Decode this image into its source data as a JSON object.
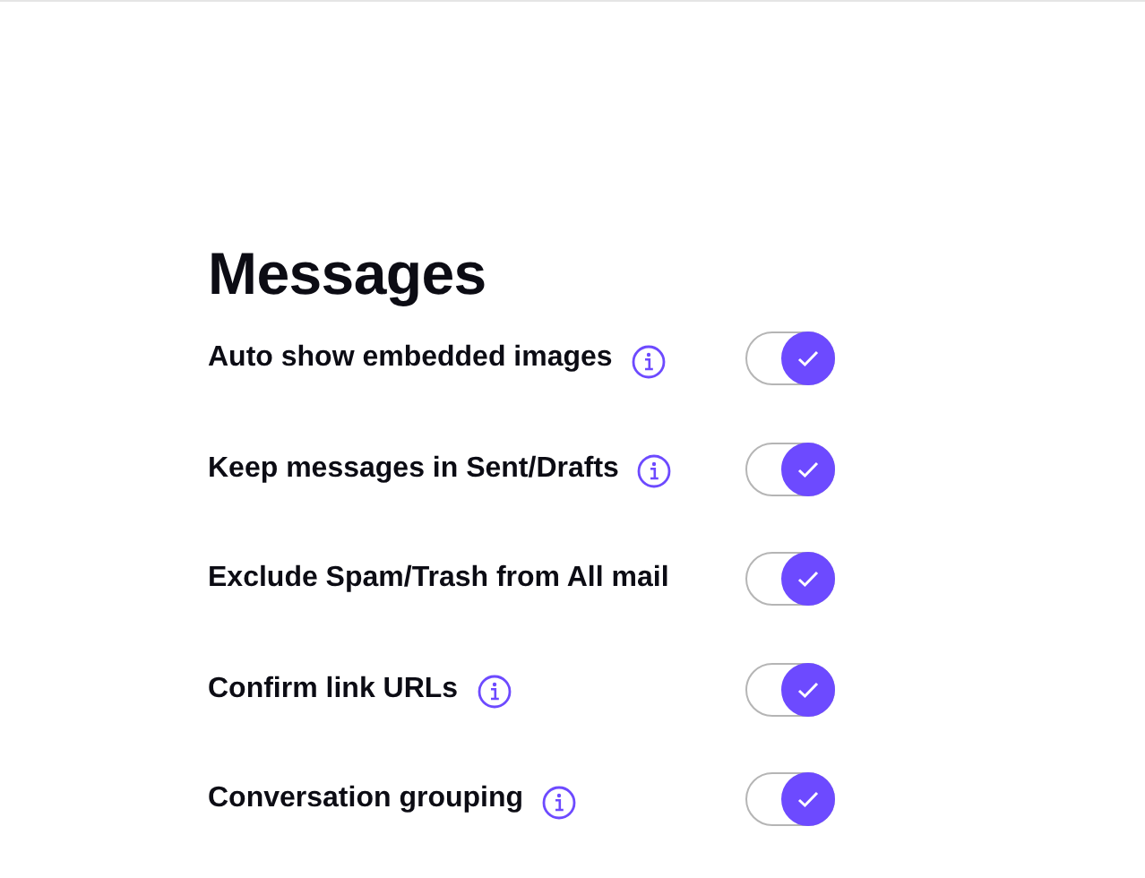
{
  "section": {
    "title": "Messages"
  },
  "settings": [
    {
      "label": "Auto show embedded images",
      "info": true,
      "on": true
    },
    {
      "label": "Keep messages in Sent/Drafts",
      "info": true,
      "on": true
    },
    {
      "label": "Exclude Spam/Trash from All mail",
      "info": false,
      "on": true
    },
    {
      "label": "Confirm link URLs",
      "info": true,
      "on": true
    },
    {
      "label": "Conversation grouping",
      "info": true,
      "on": true
    }
  ]
}
